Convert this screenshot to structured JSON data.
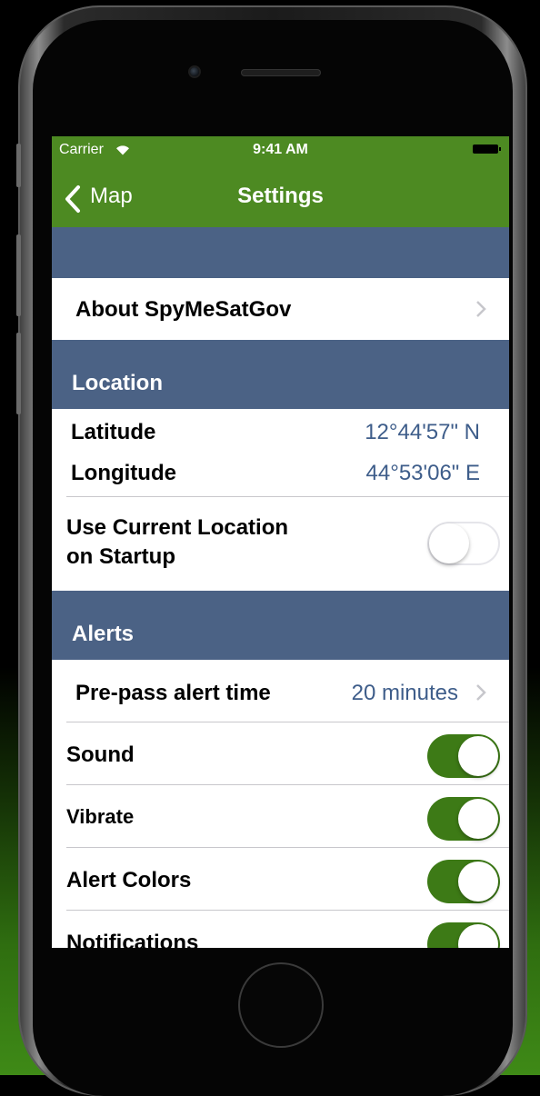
{
  "status_bar": {
    "carrier": "Carrier",
    "time": "9:41 AM"
  },
  "navigation": {
    "back_label": "Map",
    "title": "Settings"
  },
  "about": {
    "label": "About SpyMeSatGov"
  },
  "location": {
    "header": "Location",
    "latitude_label": "Latitude",
    "latitude_value": "12°44'57\" N",
    "longitude_label": "Longitude",
    "longitude_value": "44°53'06\" E",
    "use_current_line1": "Use Current Location",
    "use_current_line2": "on Startup",
    "use_current_on": false
  },
  "alerts": {
    "header": "Alerts",
    "prepass_label": "Pre-pass alert time",
    "prepass_value": "20 minutes",
    "items": [
      {
        "label": "Sound",
        "on": true
      },
      {
        "label": "Vibrate",
        "on": true
      },
      {
        "label": "Alert Colors",
        "on": true
      },
      {
        "label": "Notifications",
        "on": true
      }
    ]
  },
  "colors": {
    "nav_green": "#4d8a22",
    "section_blue": "#4b6285",
    "value_blue": "#3e5d8a",
    "toggle_green": "#3d7a16"
  }
}
